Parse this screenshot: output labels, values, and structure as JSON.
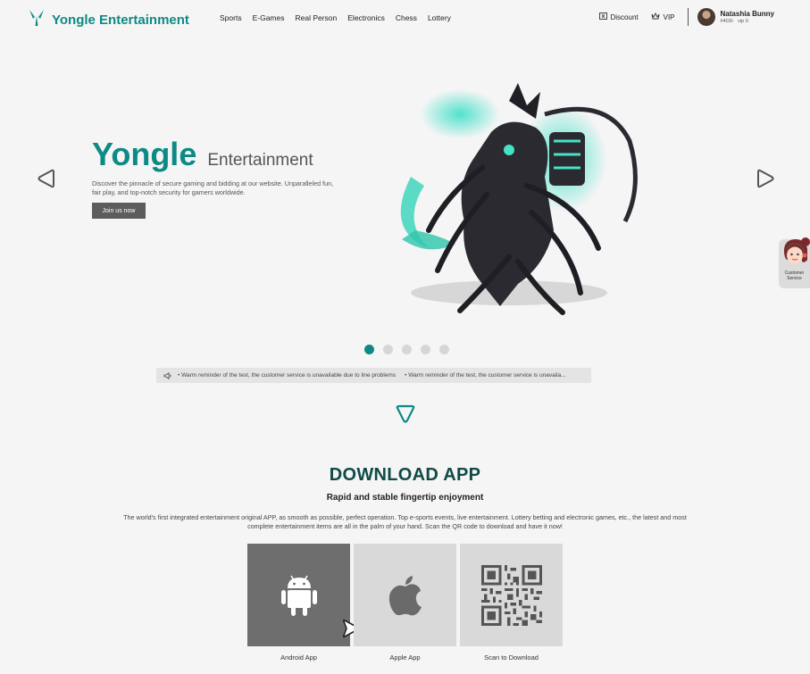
{
  "header": {
    "brand": "Yongle Entertainment",
    "nav": [
      "Sports",
      "E-Games",
      "Real Person",
      "Electronics",
      "Chess",
      "Lottery"
    ],
    "discount_label": "Discount",
    "vip_label": "VIP",
    "user": {
      "name": "Natashia Bunny",
      "id": "#403/-",
      "level": "vip 0"
    }
  },
  "hero": {
    "title_big": "Yongle",
    "title_small": "Entertainment",
    "description": "Discover the pinnacle of secure gaming and bidding at our website. Unparalleled fun, fair play, and top-notch security for gamers worldwide.",
    "cta_label": "Join us now",
    "slide_count": 5,
    "active_slide": 1
  },
  "notice": {
    "messages": [
      "Warm reminder of the test, the customer service is unavailable due to line problems",
      "Warm reminder of the test, the customer service is unavaila..."
    ]
  },
  "download": {
    "title": "DOWNLOAD APP",
    "subtitle": "Rapid and stable fingertip enjoyment",
    "description": "The world's first integrated entertainment original APP, as smooth as possible, perfect operation. Top e-sports events, live entertainment. Lottery betting and electronic games, etc., the latest and most complete entertainment items are all in the palm of your hand. Scan the QR code to download and have it now!",
    "tiles": [
      "Android App",
      "Apple App",
      "Scan to Download"
    ]
  },
  "customer_service": {
    "label": "Customer Service"
  },
  "colors": {
    "brand": "#0d8a86",
    "dark_teal": "#0f4a47",
    "button": "#5c5c5c"
  }
}
